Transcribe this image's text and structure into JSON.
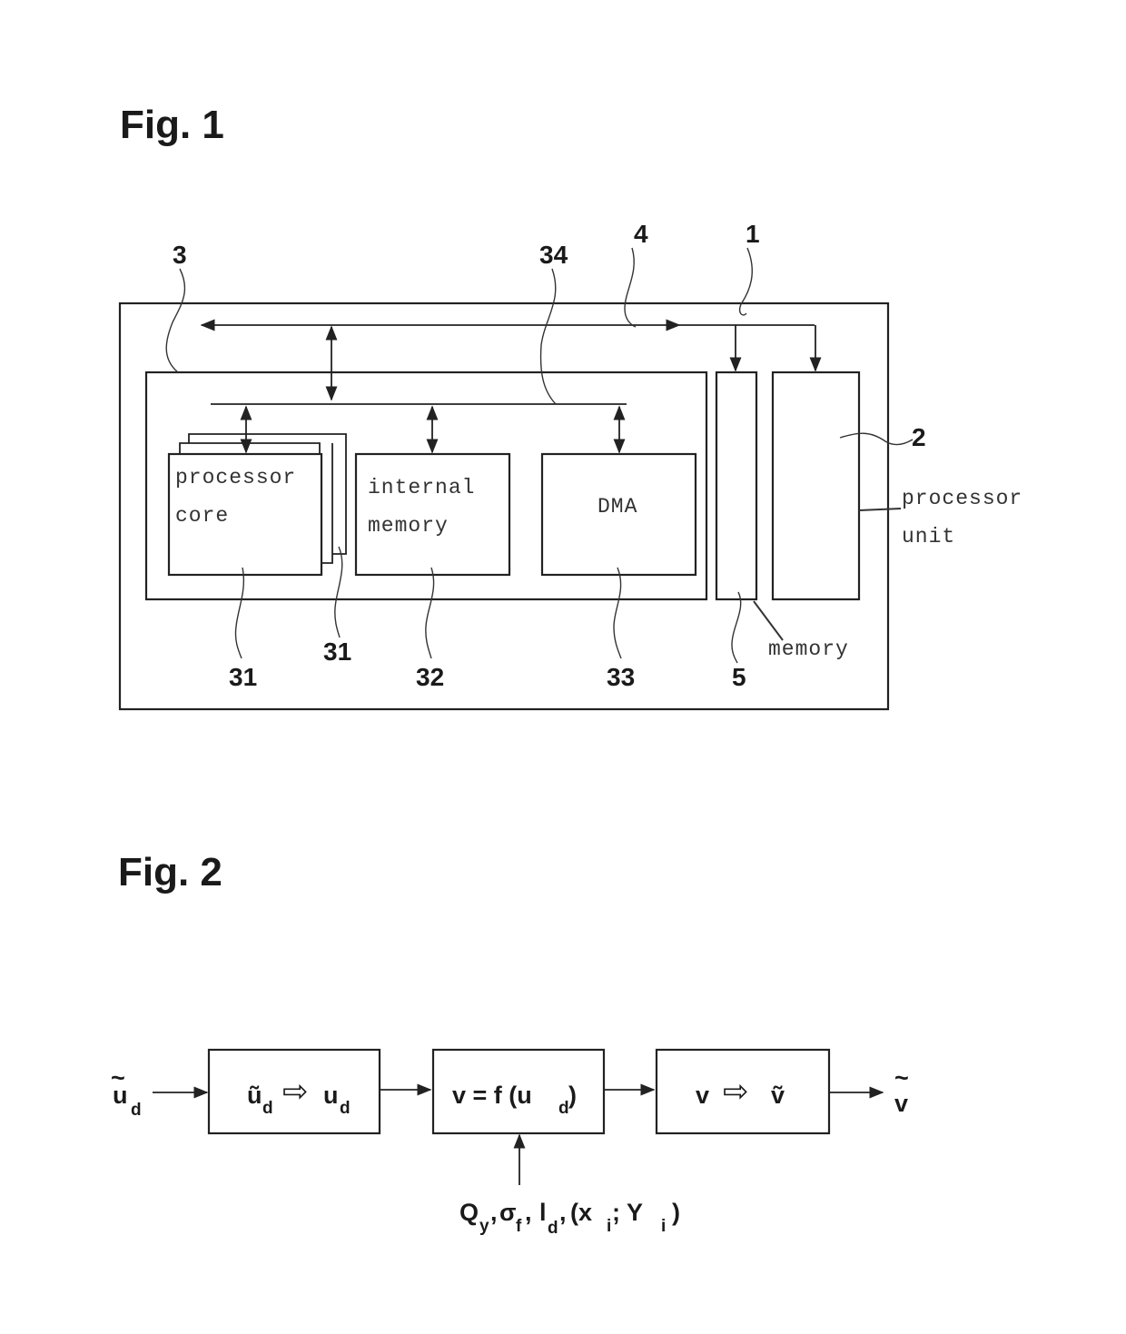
{
  "figures": [
    {
      "title": "Fig. 1",
      "reference_numerals": {
        "device": "1",
        "processor_unit": "2",
        "accelerator": "3",
        "system_bus": "4",
        "memory": "5",
        "processor_core": "31",
        "processor_core_stack": "31",
        "internal_memory": "32",
        "dma": "33",
        "internal_bus": "34"
      },
      "blocks": {
        "processor_core": [
          "processor",
          "core"
        ],
        "internal_memory": [
          "internal",
          "memory"
        ],
        "dma": "DMA",
        "processor_unit": [
          "processor",
          "unit"
        ],
        "memory": "memory"
      }
    },
    {
      "title": "Fig. 2",
      "input": {
        "symbol": "u",
        "accent": "~",
        "subscript": "d"
      },
      "blocks": [
        {
          "from": "ũ",
          "from_sub": "d",
          "arrow": "⇨",
          "to": "u",
          "to_sub": "d"
        },
        {
          "lhs": "v = f (u",
          "sub": "d",
          "rhs": ")"
        },
        {
          "from": "v",
          "arrow": "⇨",
          "to": "ṽ"
        }
      ],
      "output": {
        "symbol": "v",
        "accent": "~"
      },
      "parameters": {
        "q": "Q",
        "q_sub": "y",
        "sigma": "σ",
        "sigma_sub": "f",
        "l": "l",
        "l_sub": "d",
        "pair_open": "(x",
        "pair_i": "i",
        "pair_sep": "; Y",
        "pair_i2": "i",
        "pair_close": ")"
      }
    }
  ]
}
